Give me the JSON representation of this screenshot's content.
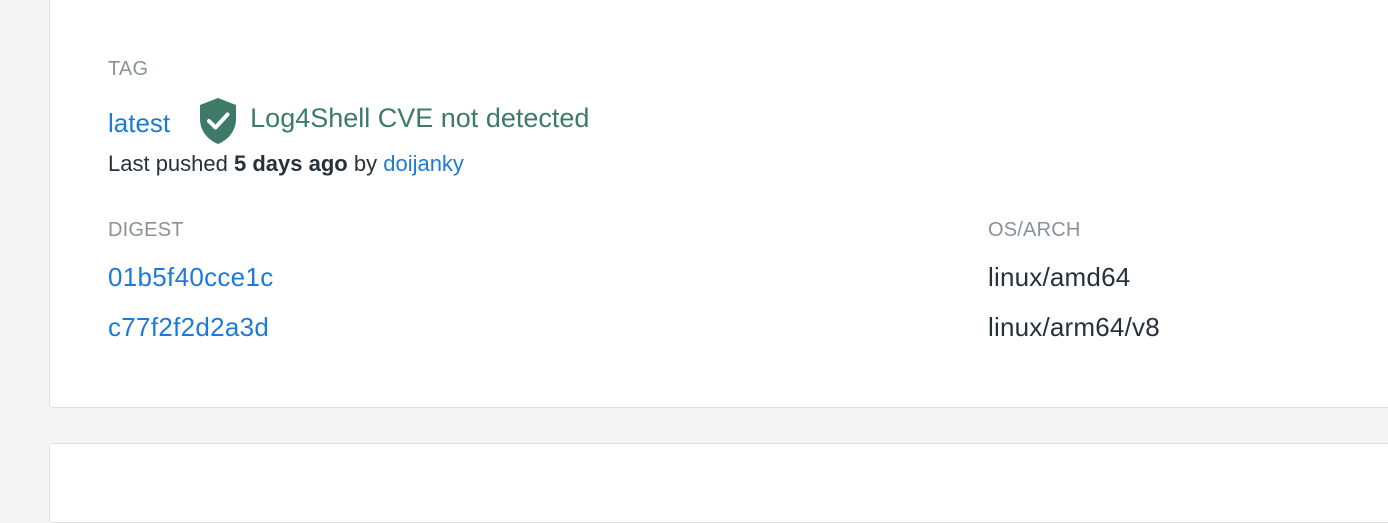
{
  "tag_section": {
    "label": "TAG",
    "tag_name": "latest",
    "scan_status": "Log4Shell CVE not detected",
    "scan_status_color": "#3d7b68",
    "scan_icon": "shield-check-icon",
    "last_pushed_prefix": "Last pushed",
    "last_pushed_time": "5 days ago",
    "last_pushed_by": "by",
    "pusher": "doijanky"
  },
  "images": {
    "digest_header": "DIGEST",
    "os_arch_header": "OS/ARCH",
    "rows": [
      {
        "digest": "01b5f40cce1c",
        "os_arch": "linux/amd64"
      },
      {
        "digest": "c77f2f2d2a3d",
        "os_arch": "linux/arm64/v8"
      }
    ]
  },
  "colors": {
    "link": "#1d7ad8",
    "muted_label": "#8a9198",
    "text": "#27313a",
    "page_background": "#f5f5f5",
    "card_border": "#dfe2e4"
  }
}
